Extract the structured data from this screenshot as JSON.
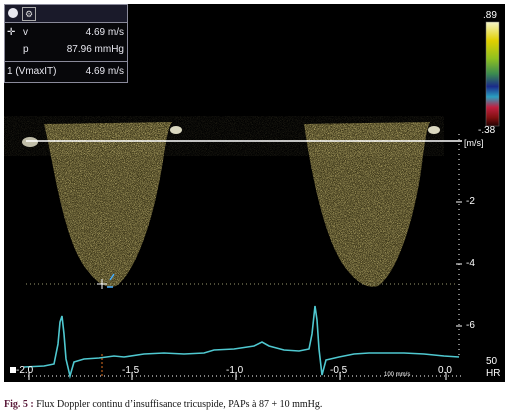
{
  "measurements": {
    "v_label": "v",
    "v_value": "4.69 m/s",
    "p_label": "p",
    "p_value": "87.96 mmHg",
    "vmax_label": "1 (VmaxIT)",
    "vmax_value": "4.69 m/s"
  },
  "color_scale": {
    "top": ".89",
    "bottom": "-.38"
  },
  "velocity_axis": {
    "unit": "[m/s]",
    "ticks": [
      "-2",
      "-4",
      "-6"
    ]
  },
  "time_axis": {
    "ticks": [
      "-2.0",
      "-1.5",
      "-1.0",
      "-0.5",
      "0.0"
    ],
    "speed": "100 mm/s"
  },
  "hr_label": {
    "value": "50",
    "unit": "HR"
  },
  "caption": {
    "label": "Fig. 5 :",
    "text": "Flux Doppler continu d’insuffisance tricuspide, PAPs à 87 + 10 mmHg."
  },
  "colors": {
    "doppler": "#d8c25a",
    "ecg": "#4fc8d0",
    "baseline": "#ffffff",
    "frame": "#8a8a9a"
  }
}
